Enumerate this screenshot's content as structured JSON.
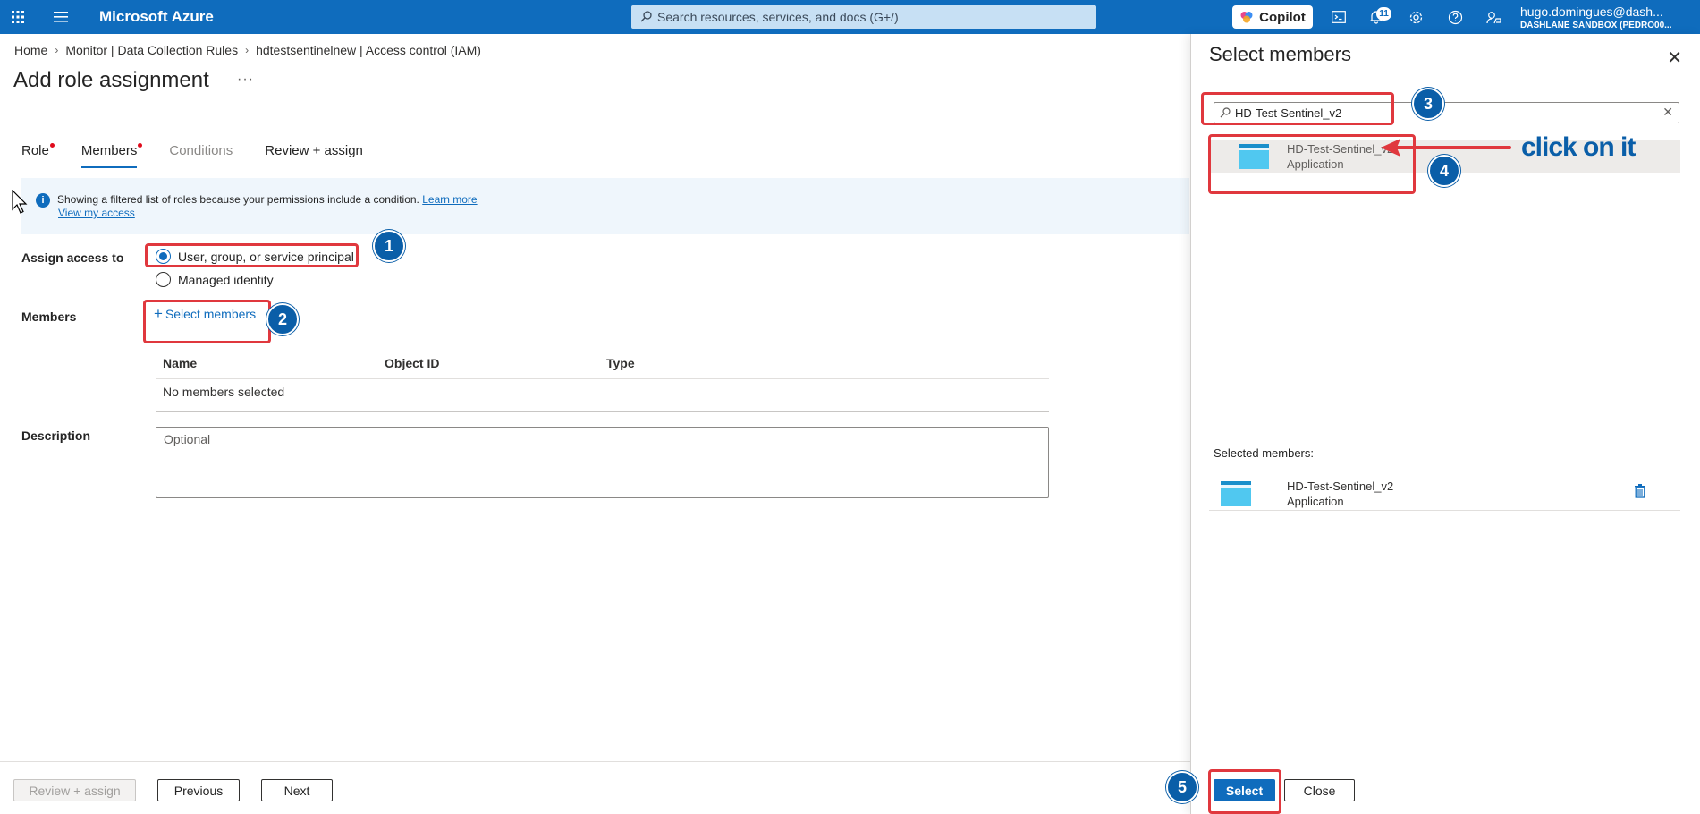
{
  "topbar": {
    "brand": "Microsoft Azure",
    "search_placeholder": "Search resources, services, and docs (G+/)",
    "copilot_label": "Copilot",
    "notifications_count": "11",
    "account_name": "hugo.domingues@dash...",
    "account_org": "DASHLANE SANDBOX (PEDRO00..."
  },
  "breadcrumb": [
    "Home",
    "Monitor | Data Collection Rules",
    "hdtestsentinelnew | Access control (IAM)"
  ],
  "page": {
    "title": "Add role assignment",
    "more": "···"
  },
  "tabs": [
    {
      "label": "Role"
    },
    {
      "label": "Members"
    },
    {
      "label": "Conditions"
    },
    {
      "label": "Review + assign"
    }
  ],
  "info": {
    "message": "Showing a filtered list of roles because your permissions include a condition.",
    "learn_more": "Learn more",
    "view_access": "View my access"
  },
  "form": {
    "assign_label": "Assign access to",
    "radio_user": "User, group, or service principal",
    "radio_managed": "Managed identity",
    "members_label": "Members",
    "select_members": "Select members",
    "columns": [
      "Name",
      "Object ID",
      "Type"
    ],
    "empty": "No members selected",
    "description_label": "Description",
    "description_placeholder": "Optional"
  },
  "footer": {
    "review": "Review + assign",
    "previous": "Previous",
    "next": "Next"
  },
  "panel": {
    "title": "Select members",
    "search_value": "HD-Test-Sentinel_v2",
    "result": {
      "name": "HD-Test-Sentinel_v2",
      "type": "Application"
    },
    "selected_label": "Selected members:",
    "selected": {
      "name": "HD-Test-Sentinel_v2",
      "type": "Application"
    },
    "select_btn": "Select",
    "close_btn": "Close"
  },
  "annotations": {
    "steps": [
      "1",
      "2",
      "3",
      "4",
      "5"
    ],
    "click_note": "click on it",
    "color_box": "#e0383e",
    "color_step": "#0a5ea8"
  },
  "colors": {
    "accent": "#0f6cbd",
    "topbar": "#0f6cbd"
  }
}
